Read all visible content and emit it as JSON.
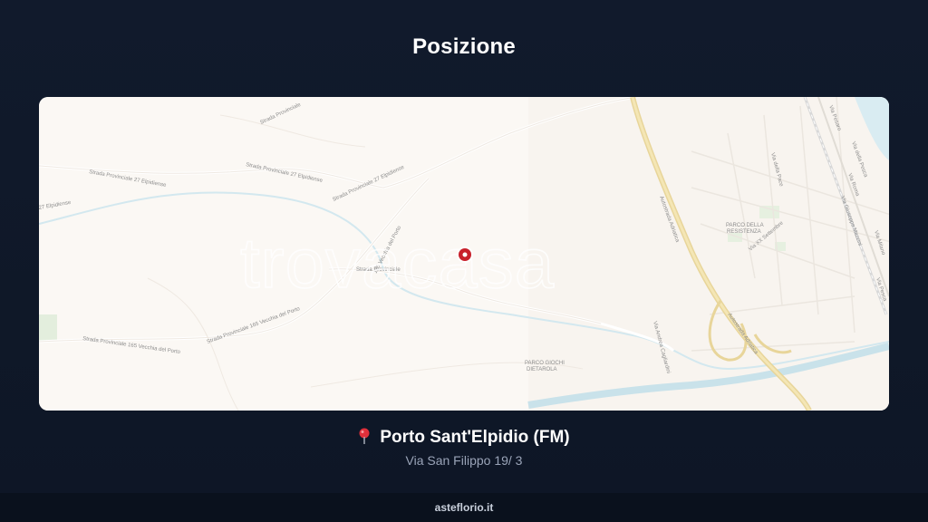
{
  "page": {
    "title": "Posizione"
  },
  "map": {
    "watermark": "trovacasa",
    "labels": {
      "sp27_a": "Strada Provinciale 27 Elpidiense",
      "sp27_b": "Strada Provinciale 27 Elpidiense",
      "sp27_c": "Strada Provinciale 27 Elpidiense",
      "sp27_left": "27 Elpidiense",
      "sp165_a": "Strada Provinciale 165 Vecchia del Porto",
      "sp165_b": "Strada Provinciale 165 Vecchia del Porto",
      "vecchia_porto": "165 Vecchia del Porto",
      "strada_prov": "Strada Provinciale",
      "strada_top": "Strada Provinciale",
      "autostrada_a": "Autostrada Adriatica",
      "autostrada_b": "Autostrada Adriatica",
      "parco_resistenza_1": "PARCO DELLA",
      "parco_resistenza_2": "RESISTENZA",
      "via_xx": "Via XX Settembre",
      "via_garibaldi": "Via Giuseppe Mazzini",
      "via_andrea": "Via Andrea Cagliardini",
      "parco_giochi_1": "PARCO GIOCHI",
      "parco_giochi_2": "DIETAROLA",
      "via_pesaro": "Via Pesaro",
      "via_della_pace": "Via della Pace",
      "via_roma": "Via Roma",
      "via_milano": "Via Milano",
      "via_pesca": "Via Pesca",
      "via_della_pesca2": "Via della Pesca"
    },
    "marker": {
      "type": "property-location",
      "color": "#c8212b"
    }
  },
  "location": {
    "pin_icon": "map-pin-icon",
    "city": "Porto Sant'Elpidio (FM)",
    "address": "Via San Filippo 19/ 3"
  },
  "footer": {
    "brand": "asteflorio.it"
  }
}
